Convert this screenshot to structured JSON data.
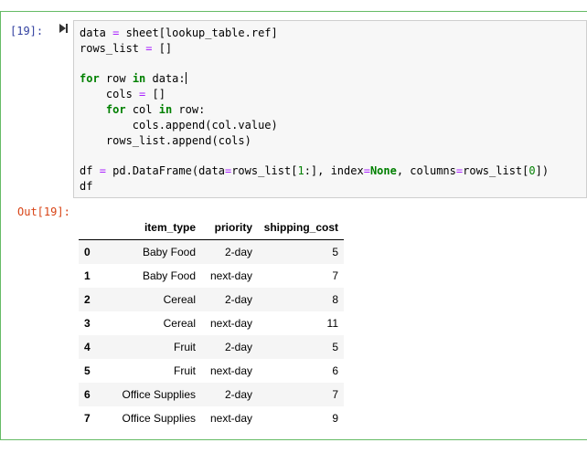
{
  "cell": {
    "in_prompt": "[19]:",
    "out_prompt": "Out[19]:"
  },
  "code": {
    "line1": "data = sheet[lookup_table.ref]",
    "line2": "rows_list = []",
    "line4": "for row in data:",
    "line5": "    cols = []",
    "line6": "    for col in row:",
    "line7": "        cols.append(col.value)",
    "line8": "    rows_list.append(cols)",
    "line10": "df = pd.DataFrame(data=rows_list[1:], index=None, columns=rows_list[0])",
    "line11": "df"
  },
  "dataframe": {
    "columns": [
      "",
      "item_type",
      "priority",
      "shipping_cost"
    ],
    "rows": [
      {
        "index": "0",
        "item_type": "Baby Food",
        "priority": "2-day",
        "shipping_cost": "5"
      },
      {
        "index": "1",
        "item_type": "Baby Food",
        "priority": "next-day",
        "shipping_cost": "7"
      },
      {
        "index": "2",
        "item_type": "Cereal",
        "priority": "2-day",
        "shipping_cost": "8"
      },
      {
        "index": "3",
        "item_type": "Cereal",
        "priority": "next-day",
        "shipping_cost": "11"
      },
      {
        "index": "4",
        "item_type": "Fruit",
        "priority": "2-day",
        "shipping_cost": "5"
      },
      {
        "index": "5",
        "item_type": "Fruit",
        "priority": "next-day",
        "shipping_cost": "6"
      },
      {
        "index": "6",
        "item_type": "Office Supplies",
        "priority": "2-day",
        "shipping_cost": "7"
      },
      {
        "index": "7",
        "item_type": "Office Supplies",
        "priority": "next-day",
        "shipping_cost": "9"
      }
    ]
  },
  "icons": {
    "run": "run-cell-icon"
  },
  "colors": {
    "cell_border": "#66bb66",
    "in_prompt": "#303f9f",
    "out_prompt": "#d84315",
    "keyword": "#008000",
    "operator": "#aa22ff"
  }
}
